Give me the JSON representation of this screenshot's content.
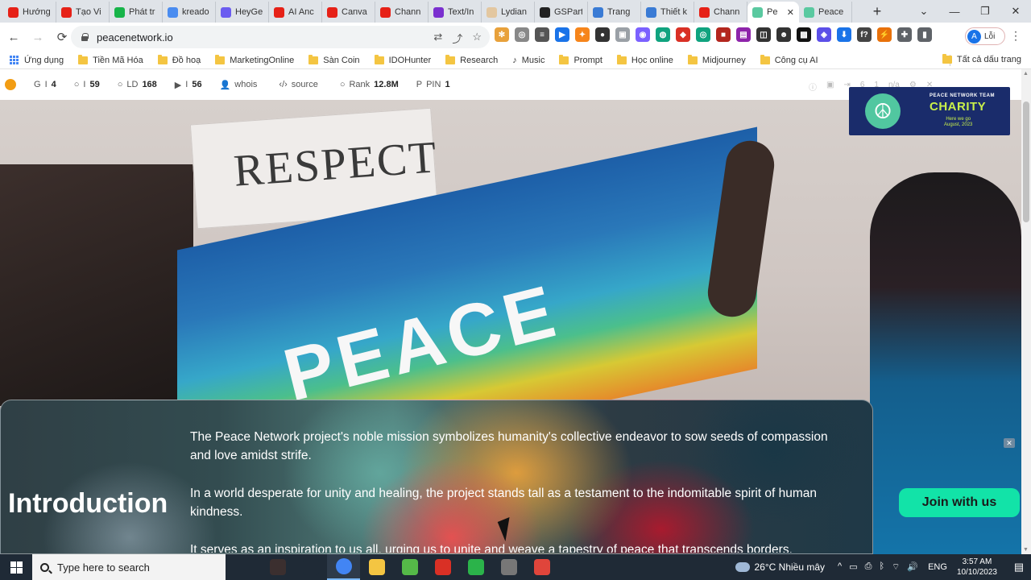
{
  "browser": {
    "tabs": [
      {
        "title": "Hướng",
        "color": "#e62117"
      },
      {
        "title": "Tạo Vi",
        "color": "#e62117"
      },
      {
        "title": "Phát tr",
        "color": "#17b449"
      },
      {
        "title": "kreado",
        "color": "#4a8cf0"
      },
      {
        "title": "HeyGe",
        "color": "#6b5cf0"
      },
      {
        "title": "AI Anc",
        "color": "#e62117"
      },
      {
        "title": "Canva",
        "color": "#e62117"
      },
      {
        "title": "Chann",
        "color": "#e62117"
      },
      {
        "title": "Text/In",
        "color": "#7a2fcf"
      },
      {
        "title": "Lydian",
        "color": "#e3c7a0"
      },
      {
        "title": "GSPart",
        "color": "#222222"
      },
      {
        "title": "Trang",
        "color": "#3a7bd5"
      },
      {
        "title": "Thiết k",
        "color": "#3a7bd5"
      },
      {
        "title": "Chann",
        "color": "#e62117"
      },
      {
        "title": "Pe",
        "color": "#5ac9a0",
        "active": true
      },
      {
        "title": "Peace",
        "color": "#5ac9a0"
      }
    ],
    "new_tab": "+",
    "window_controls": [
      "⌄",
      "—",
      "❐",
      "✕"
    ],
    "nav": {
      "back": "←",
      "forward": "→",
      "reload": "⟳"
    },
    "url": "peacenetwork.io",
    "omni_icons": [
      "⇄",
      "⤴",
      "☆"
    ],
    "extensions": [
      {
        "glyph": "✻",
        "color": "#e8a13b"
      },
      {
        "glyph": "◎",
        "color": "#888888"
      },
      {
        "glyph": "≡",
        "color": "#555555"
      },
      {
        "glyph": "▶",
        "color": "#1a73e8"
      },
      {
        "glyph": "✦",
        "color": "#f6851b"
      },
      {
        "glyph": "●",
        "color": "#333333"
      },
      {
        "glyph": "▣",
        "color": "#9aa0a6"
      },
      {
        "glyph": "◉",
        "color": "#7b61ff"
      },
      {
        "glyph": "◍",
        "color": "#10a37f"
      },
      {
        "glyph": "◆",
        "color": "#d93025"
      },
      {
        "glyph": "◎",
        "color": "#10a37f"
      },
      {
        "glyph": "■",
        "color": "#b3261e"
      },
      {
        "glyph": "▤",
        "color": "#8e24aa"
      },
      {
        "glyph": "◫",
        "color": "#333333"
      },
      {
        "glyph": "☻",
        "color": "#333333"
      },
      {
        "glyph": "▩",
        "color": "#111111"
      },
      {
        "glyph": "◈",
        "color": "#5b4fe8"
      },
      {
        "glyph": "⬇",
        "color": "#1a73e8"
      },
      {
        "glyph": "f?",
        "color": "#444444"
      },
      {
        "glyph": "⚡",
        "color": "#e8710a"
      },
      {
        "glyph": "✚",
        "color": "#5f6368"
      },
      {
        "glyph": "▮",
        "color": "#5f6368"
      }
    ],
    "profile": {
      "initial": "A",
      "label": "Lỗi"
    },
    "menu": "⋮"
  },
  "bookmarks": {
    "items": [
      {
        "label": "Ứng dụng",
        "kind": "apps"
      },
      {
        "label": "Tiền Mã Hóa",
        "kind": "folder"
      },
      {
        "label": "Đồ hoạ",
        "kind": "folder"
      },
      {
        "label": "MarketingOnline",
        "kind": "folder"
      },
      {
        "label": "Sàn Coin",
        "kind": "folder"
      },
      {
        "label": "IDOHunter",
        "kind": "folder"
      },
      {
        "label": "Research",
        "kind": "folder"
      },
      {
        "label": "Music",
        "kind": "music"
      },
      {
        "label": "Prompt",
        "kind": "folder"
      },
      {
        "label": "Học online",
        "kind": "folder"
      },
      {
        "label": "Midjourney",
        "kind": "folder"
      },
      {
        "label": "Công cụ AI",
        "kind": "folder"
      }
    ],
    "all_bookmarks": "Tất cả dấu trang"
  },
  "seo_bar": {
    "items": [
      {
        "label": "I",
        "value": "4",
        "icon": "G"
      },
      {
        "label": "I",
        "value": "59",
        "icon": "○"
      },
      {
        "label": "LD",
        "value": "168",
        "icon": "○"
      },
      {
        "label": "I",
        "value": "56",
        "icon": "▶"
      },
      {
        "label": "whois",
        "value": "",
        "icon": "👤"
      },
      {
        "label": "source",
        "value": "",
        "icon": "‹/›"
      },
      {
        "label": "Rank",
        "value": "12.8M",
        "icon": "○"
      },
      {
        "label": "PIN",
        "value": "1",
        "icon": "P"
      }
    ],
    "right_items": [
      "ⓘ",
      "▣",
      "⇥",
      "6",
      "1",
      "n/a",
      "⚙",
      "✕"
    ]
  },
  "hero": {
    "sign_text": "RESPECT",
    "flag_text": "PEACE"
  },
  "charity_banner": {
    "line1": "PEACE NETWORK TEAM",
    "line2": "CHARITY",
    "line3": "Here we go",
    "line4": "August, 2023",
    "symbol": "☮"
  },
  "intro": {
    "title": "Introduction",
    "paragraphs": [
      "The Peace Network project's noble mission symbolizes humanity's collective endeavor to sow seeds of compassion and love amidst strife.",
      "In a world desperate for unity and healing, the project stands tall as a testament to the indomitable spirit of human kindness.",
      "It serves as an inspiration to us all, urging us to unite and weave a tapestry of peace that transcends borders."
    ],
    "join_button": "Join with us",
    "close_glyph": "✕"
  },
  "taskbar": {
    "search_placeholder": "Type here to search",
    "apps": [
      {
        "name": "avatar",
        "color": "#3b2f2f"
      },
      {
        "name": "task-view",
        "color": "#1f2a36"
      },
      {
        "name": "chrome",
        "color": "#4285f4",
        "active": true
      },
      {
        "name": "file-explorer",
        "color": "#f4c542"
      },
      {
        "name": "app-green",
        "color": "#55b948"
      },
      {
        "name": "app-red",
        "color": "#d93025"
      },
      {
        "name": "app-camtasia",
        "color": "#2bb34a"
      },
      {
        "name": "app-device",
        "color": "#777777"
      },
      {
        "name": "app-capcut",
        "color": "#e0453b"
      }
    ],
    "weather": "26°C  Nhiều mây",
    "tray_icons": [
      "^",
      "▭",
      "⎙",
      "ᛒ",
      "⌔",
      "🔊"
    ],
    "language": "ENG",
    "time": "3:57 AM",
    "date": "10/10/2023",
    "notification": "▤"
  }
}
